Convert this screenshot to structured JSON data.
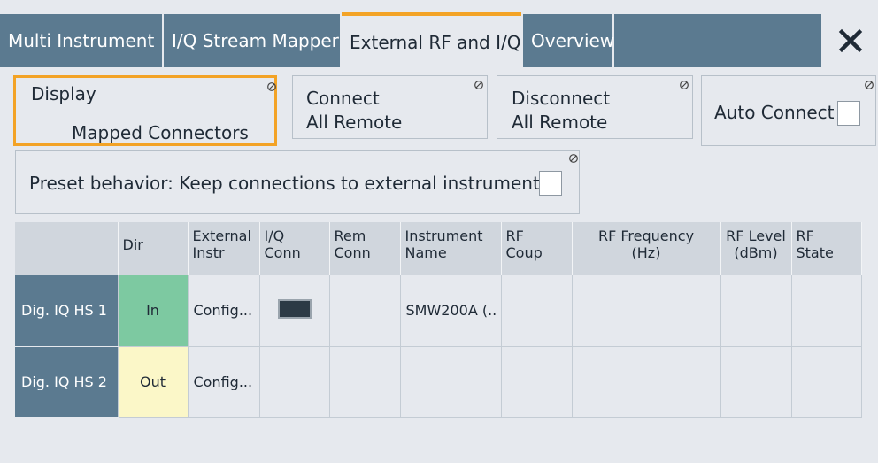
{
  "tabs": [
    {
      "label": "Multi Instrument"
    },
    {
      "label": "I/Q Stream Mapper"
    },
    {
      "label": "External RF and I/Q"
    },
    {
      "label": "Overview"
    }
  ],
  "toolbar": {
    "display_label_line1": "Display",
    "display_label_line2": "Mapped Connectors",
    "connect_line1": "Connect",
    "connect_line2": "All Remote",
    "disconnect_line1": "Disconnect",
    "disconnect_line2": "All Remote",
    "auto_connect_label": "Auto Connect",
    "preset_label": "Preset behavior: Keep connections to external instruments"
  },
  "table": {
    "headers": [
      "",
      "Dir",
      "External Instr",
      "I/Q Conn",
      "Rem Conn",
      "Instrument Name",
      "RF Coup",
      "RF Frequency (Hz)",
      "RF Level (dBm)",
      "RF State"
    ],
    "header_lines": [
      [
        "",
        ""
      ],
      [
        "Dir",
        ""
      ],
      [
        "External",
        "Instr"
      ],
      [
        "I/Q",
        "Conn"
      ],
      [
        "Rem",
        "Conn"
      ],
      [
        "Instrument",
        "Name"
      ],
      [
        "RF",
        "Coup"
      ],
      [
        "RF Frequency",
        "(Hz)"
      ],
      [
        "RF Level",
        "(dBm)"
      ],
      [
        "RF",
        "State"
      ]
    ],
    "rows": [
      {
        "name": "Dig. IQ HS 1",
        "dir": "In",
        "external": "Config...",
        "instrument": "SMW200A (.."
      },
      {
        "name": "Dig. IQ HS 2",
        "dir": "Out",
        "external": "Config...",
        "instrument": ""
      }
    ]
  },
  "colors": {
    "accent": "#f3a326",
    "tab_bg": "#5b7a90",
    "dir_in": "#7dc9a1",
    "dir_out": "#fbf7c8"
  }
}
